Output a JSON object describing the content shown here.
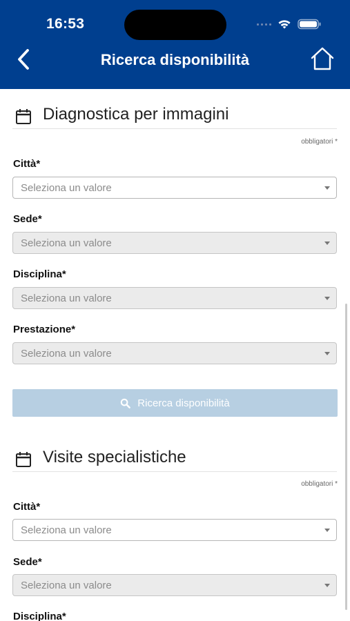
{
  "status_bar": {
    "time": "16:53"
  },
  "nav": {
    "title": "Ricerca disponibilità"
  },
  "sections": [
    {
      "title": "Diagnostica per immagini",
      "required_note": "obbligatori *",
      "fields": [
        {
          "label": "Città*",
          "placeholder": "Seleziona un valore"
        },
        {
          "label": "Sede*",
          "placeholder": "Seleziona un valore"
        },
        {
          "label": "Disciplina*",
          "placeholder": "Seleziona un valore"
        },
        {
          "label": "Prestazione*",
          "placeholder": "Seleziona un valore"
        }
      ],
      "search_button": "Ricerca disponibilità"
    },
    {
      "title": "Visite specialistiche",
      "required_note": "obbligatori *",
      "fields": [
        {
          "label": "Città*",
          "placeholder": "Seleziona un valore"
        },
        {
          "label": "Sede*",
          "placeholder": "Seleziona un valore"
        },
        {
          "label": "Disciplina*",
          "placeholder": ""
        }
      ]
    }
  ]
}
